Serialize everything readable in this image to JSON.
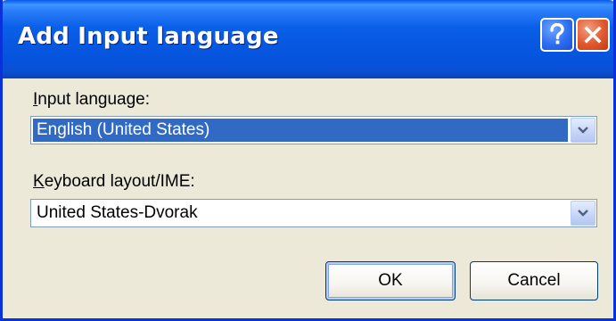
{
  "window": {
    "title": "Add Input language"
  },
  "titlebar_buttons": {
    "help_glyph": "?",
    "close_glyph": "✕"
  },
  "input_language": {
    "label_accel": "I",
    "label_rest": "nput language:",
    "value": "English (United States)"
  },
  "keyboard_layout": {
    "label_accel": "K",
    "label_rest": "eyboard layout/IME:",
    "value": "United States-Dvorak"
  },
  "buttons": {
    "ok": "OK",
    "cancel": "Cancel"
  },
  "colors": {
    "titlebar_blue": "#0553dc",
    "selection_blue": "#316ac5",
    "dialog_face": "#ece9d8",
    "close_red": "#e2572f"
  },
  "icons": {
    "help": "help-question-icon",
    "close": "close-x-icon",
    "dropdown": "chevron-down-icon"
  }
}
